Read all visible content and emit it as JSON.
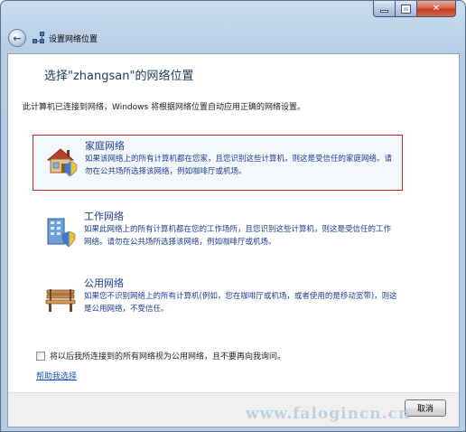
{
  "window": {
    "title": "设置网络位置",
    "caption_buttons": {
      "minimize": "minimize-icon",
      "maximize": "maximize-icon",
      "close": "✕"
    }
  },
  "dialog": {
    "heading": "选择\"zhangsan\"的网络位置",
    "intro": "此计算机已连接到网络，Windows 将根据网络位置自动应用正确的网络设置。",
    "options": [
      {
        "title": "家庭网络",
        "description": "如果该网络上的所有计算机都在您家，且您识别这些计算机，则这是受信任的家庭网络。请勿在公共场所选择该网络，例如咖啡厅或机场。",
        "icon": "house-icon",
        "selected": true
      },
      {
        "title": "工作网络",
        "description": "如果此网络上的所有计算机都在您的工作场所，且您识别这些计算机，则这是受信任的工作网络。请勿在公共场所选择该网络，例如咖啡厅或机场。",
        "icon": "office-building-icon",
        "selected": false
      },
      {
        "title": "公用网络",
        "description": "如果您不识别网络上的所有计算机(例如，您在咖啡厅或机场，或者使用的是移动宽带)，则这是公用网络，不受信任。",
        "icon": "park-bench-icon",
        "selected": false
      }
    ],
    "checkbox_label": "将以后我所连接到的所有网络视为公用网络，且不要再向我询问。",
    "checkbox_checked": false,
    "help_link": "帮助我选择",
    "cancel_label": "取消"
  },
  "watermark": "www.falogincn.cn",
  "colors": {
    "accent_link": "#1a3c8c",
    "selection_border": "#c0262a",
    "heading": "#1e395b"
  }
}
